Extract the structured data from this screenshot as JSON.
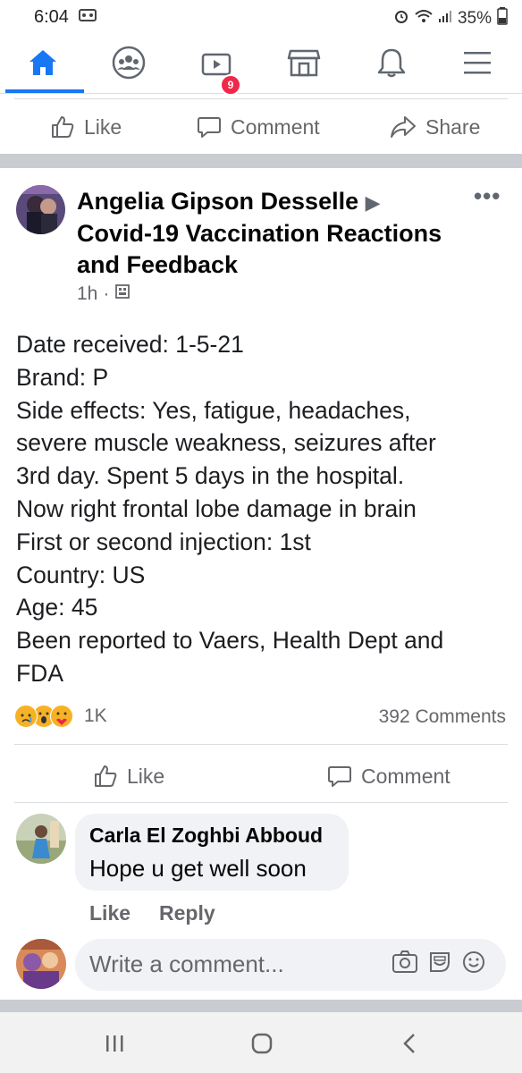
{
  "status": {
    "time": "6:04",
    "battery": "35%"
  },
  "nav": {
    "items": [
      "home",
      "groups",
      "watch",
      "marketplace",
      "notifications",
      "menu"
    ],
    "watch_badge": "9"
  },
  "top_actions": {
    "like": "Like",
    "comment": "Comment",
    "share": "Share"
  },
  "post": {
    "author": "Angelia Gipson Desselle",
    "arrow": "▶",
    "group": "Covid-19 Vaccination Reactions and Feedback",
    "time": "1h",
    "more": "•••",
    "body_lines": [
      "Date received: 1-5-21",
      "Brand: P",
      "Side effects: Yes, fatigue, headaches,",
      "severe muscle weakness, seizures after",
      "3rd day. Spent 5 days in the hospital.",
      "Now right frontal lobe damage in brain",
      "First or second injection: 1st",
      "Country: US",
      "Age: 45",
      "Been reported to Vaers, Health Dept and",
      "FDA"
    ],
    "reactions_count": "1K",
    "comments_count": "392 Comments",
    "like": "Like",
    "comment": "Comment"
  },
  "comment": {
    "author": "Carla El Zoghbi Abboud",
    "text": "Hope u get well soon",
    "like": "Like",
    "reply": "Reply"
  },
  "composer": {
    "placeholder": "Write a comment..."
  },
  "colors": {
    "accent": "#1877f2",
    "badge": "#f02849",
    "separator": "#c9ccd1"
  }
}
